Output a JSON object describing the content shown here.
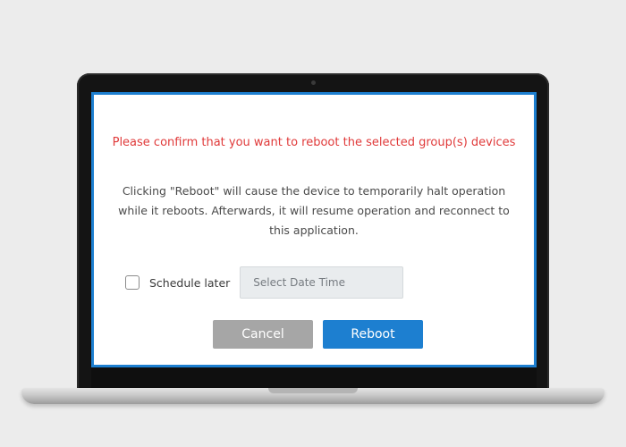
{
  "dialog": {
    "warning_text": "Please confirm that you want to reboot the selected group(s) devices",
    "message_text": "Clicking \"Reboot\" will cause the device to temporarily halt operation while it reboots. Afterwards, it will resume operation and reconnect to this application.",
    "schedule": {
      "label": "Schedule later",
      "checked": false,
      "date_placeholder": "Select Date Time",
      "date_value": ""
    },
    "buttons": {
      "cancel_label": "Cancel",
      "reboot_label": "Reboot"
    }
  },
  "colors": {
    "accent": "#1d7fd0",
    "warning": "#e03a3a",
    "cancel_button": "#a6a6a6",
    "background": "#ececec"
  },
  "icons": {
    "checkbox": "checkbox-unchecked-icon"
  }
}
